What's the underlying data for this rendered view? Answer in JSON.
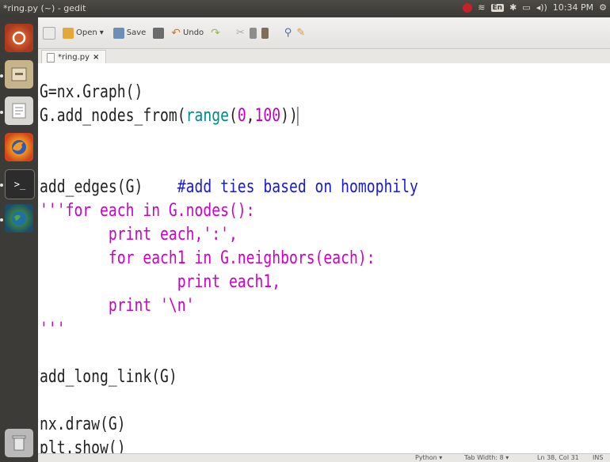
{
  "window": {
    "title": "*ring.py (~) - gedit"
  },
  "indicators": {
    "keyboard": "En",
    "volume": "◂))",
    "clock": "10:34 PM"
  },
  "toolbar": {
    "open_label": "Open",
    "save_label": "Save",
    "undo_label": "Undo"
  },
  "tabs": [
    {
      "label": "*ring.py",
      "close": "×"
    }
  ],
  "code_lines": [
    "G=nx.Graph()",
    "G.add_nodes_from(range(0,100))",
    "",
    "",
    "add_edges(G)    #add ties based on homophily",
    "'''for each in G.nodes():",
    "        print each,':',",
    "        for each1 in G.neighbors(each):",
    "                print each1,",
    "        print '\\n'",
    "'''",
    "",
    "add_long_link(G)",
    "",
    "nx.draw(G)",
    "plt.show()"
  ],
  "statusbar": {
    "language": "Python ▾",
    "tab_width": "Tab Width: 8 ▾",
    "position": "Ln 38, Col 31",
    "mode": "INS"
  },
  "colors": {
    "string": "#cf00c5",
    "comment": "#1a1adc",
    "builtin": "#008a8c"
  }
}
